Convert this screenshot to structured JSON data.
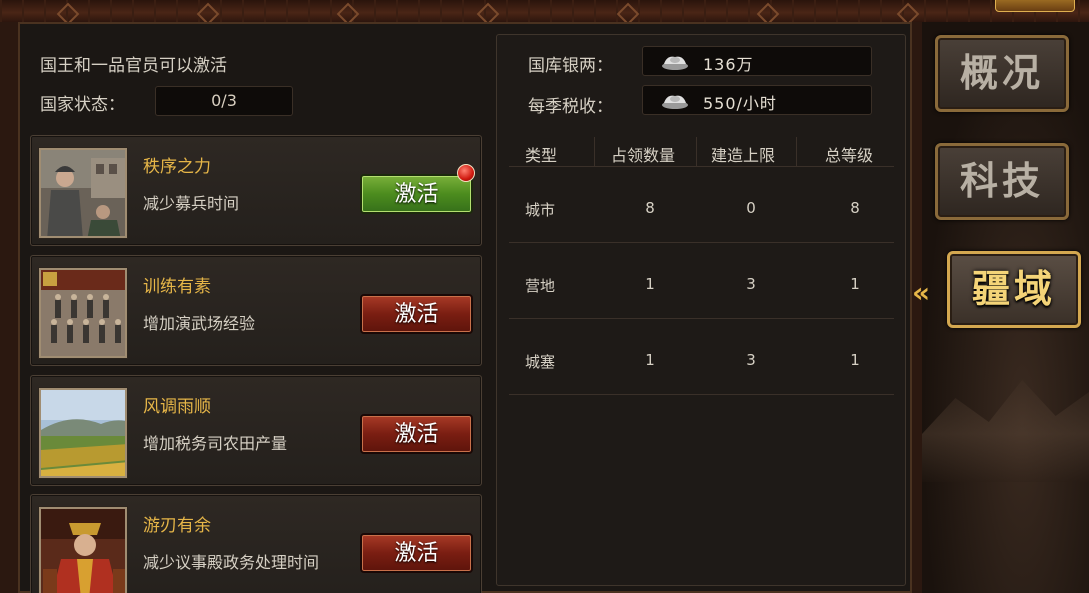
{
  "left": {
    "note": "国王和一品官员可以激活",
    "status_label": "国家状态：",
    "status_value": "0/3",
    "cards": [
      {
        "title": "秩序之力",
        "desc": "减少募兵时间",
        "button": "激活",
        "button_color": "green",
        "has_alert": true
      },
      {
        "title": "训练有素",
        "desc": "增加演武场经验",
        "button": "激活",
        "button_color": "red",
        "has_alert": false
      },
      {
        "title": "风调雨顺",
        "desc": "增加税务司农田产量",
        "button": "激活",
        "button_color": "red",
        "has_alert": false
      },
      {
        "title": "游刃有余",
        "desc": "减少议事殿政务处理时间",
        "button": "激活",
        "button_color": "red",
        "has_alert": false
      }
    ]
  },
  "right": {
    "treasury_label": "国库银两：",
    "treasury_value": "136万",
    "tax_label": "每季税收：",
    "tax_value": "550/小时",
    "table": {
      "headers": [
        "类型",
        "占领数量",
        "建造上限",
        "总等级"
      ],
      "rows": [
        [
          "城市",
          "8",
          "0",
          "8"
        ],
        [
          "营地",
          "1",
          "3",
          "1"
        ],
        [
          "城塞",
          "1",
          "3",
          "1"
        ]
      ]
    }
  },
  "tabs": [
    {
      "label": "概况",
      "active": false
    },
    {
      "label": "科技",
      "active": false
    },
    {
      "label": "疆域",
      "active": true
    }
  ],
  "active_indicator": "«",
  "colors": {
    "gold": "#e6b648",
    "red_button": "#7a1e12",
    "green_button": "#4c8c1e"
  }
}
